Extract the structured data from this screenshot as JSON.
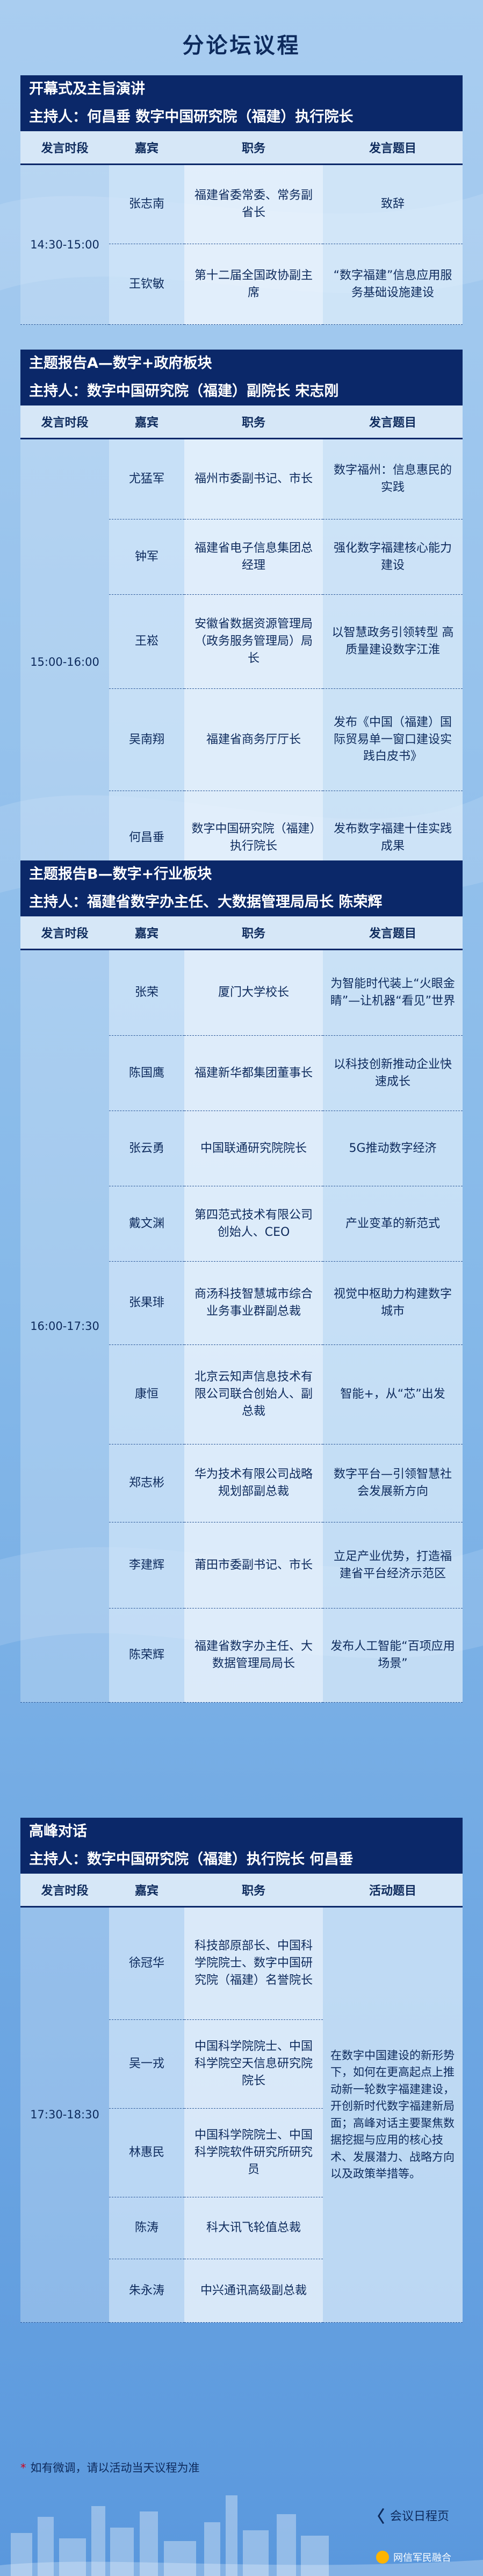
{
  "title": "分论坛议程",
  "headers": [
    "发言时段",
    "嘉宾",
    "职务",
    "发言题目"
  ],
  "headers_last": [
    "发言时段",
    "嘉宾",
    "职务",
    "活动题目"
  ],
  "s1": {
    "title": "开幕式及主旨演讲",
    "host": "主持人：何昌垂 数字中国研究院（福建）执行院长",
    "time": "14:30-15:00",
    "rows": [
      {
        "guest": "张志南",
        "job": "福建省委常委、常务副省长",
        "topic": "致辞"
      },
      {
        "guest": "王钦敏",
        "job": "第十二届全国政协副主席",
        "topic": "“数字福建”信息应用服务基础设施建设"
      }
    ]
  },
  "s2": {
    "title": "主题报告A—数字+政府板块",
    "host": "主持人：数字中国研究院（福建）副院长 宋志刚",
    "time": "15:00-16:00",
    "rows": [
      {
        "guest": "尤猛军",
        "job": "福州市委副书记、市长",
        "topic": "数字福州：信息惠民的实践"
      },
      {
        "guest": "钟军",
        "job": "福建省电子信息集团总经理",
        "topic": "强化数字福建核心能力建设"
      },
      {
        "guest": "王崧",
        "job": "安徽省数据资源管理局（政务服务管理局）局长",
        "topic": "以智慧政务引领转型 高质量建设数字江淮"
      },
      {
        "guest": "吴南翔",
        "job": "福建省商务厅厅长",
        "topic": "发布《中国（福建）国际贸易单一窗口建设实践白皮书》"
      },
      {
        "guest": "何昌垂",
        "job": "数字中国研究院（福建）执行院长",
        "topic": "发布数字福建十佳实践成果"
      }
    ]
  },
  "s3": {
    "title": "主题报告B—数字+行业板块",
    "host": "主持人：福建省数字办主任、大数据管理局局长 陈荣辉",
    "time": "16:00-17:30",
    "rows": [
      {
        "guest": "张荣",
        "job": "厦门大学校长",
        "topic": "为智能时代装上“火眼金睛”—让机器“看见”世界"
      },
      {
        "guest": "陈国鹰",
        "job": "福建新华都集团董事长",
        "topic": "以科技创新推动企业快速成长"
      },
      {
        "guest": "张云勇",
        "job": "中国联通研究院院长",
        "topic": "5G推动数字经济"
      },
      {
        "guest": "戴文渊",
        "job": "第四范式技术有限公司创始人、CEO",
        "topic": "产业变革的新范式"
      },
      {
        "guest": "张果琲",
        "job": "商汤科技智慧城市综合业务事业群副总裁",
        "topic": "视觉中枢助力构建数字城市"
      },
      {
        "guest": "康恒",
        "job": "北京云知声信息技术有限公司联合创始人、副总裁",
        "topic": "智能+，从“芯”出发"
      },
      {
        "guest": "郑志彬",
        "job": "华为技术有限公司战略规划部副总裁",
        "topic": "数字平台—引领智慧社会发展新方向"
      },
      {
        "guest": "李建辉",
        "job": "莆田市委副书记、市长",
        "topic": "立足产业优势，打造福建省平台经济示范区"
      },
      {
        "guest": "陈荣辉",
        "job": "福建省数字办主任、大数据管理局局长",
        "topic": "发布人工智能“百项应用场景”"
      }
    ]
  },
  "s4": {
    "title": "高峰对话",
    "host": "主持人：数字中国研究院（福建）执行院长 何昌垂",
    "time": "17:30-18:30",
    "topic": "在数字中国建设的新形势下，如何在更高起点上推动新一轮数字福建建设，开创新时代数字福建新局面；高峰对话主要聚焦数据挖掘与应用的核心技术、发展潜力、战略方向以及政策举措等。",
    "rows": [
      {
        "guest": "徐冠华",
        "job": "科技部原部长、中国科学院院士、数字中国研究院（福建）名誉院长"
      },
      {
        "guest": "吴一戎",
        "job": "中国科学院院士、中国科学院空天信息研究院院长"
      },
      {
        "guest": "林惠民",
        "job": "中国科学院院士、中国科学院软件研究所研究员"
      },
      {
        "guest": "陈涛",
        "job": "科大讯飞轮值总裁"
      },
      {
        "guest": "朱永涛",
        "job": "中兴通讯高级副总裁"
      }
    ]
  },
  "note": "如有微调，请以活动当天议程为准",
  "return_label": "会议日程页",
  "watermark": "网信军民融合",
  "colors": {
    "navy": "#0b2869",
    "bg": "#7fb4e6",
    "note_star": "#d0021b"
  }
}
